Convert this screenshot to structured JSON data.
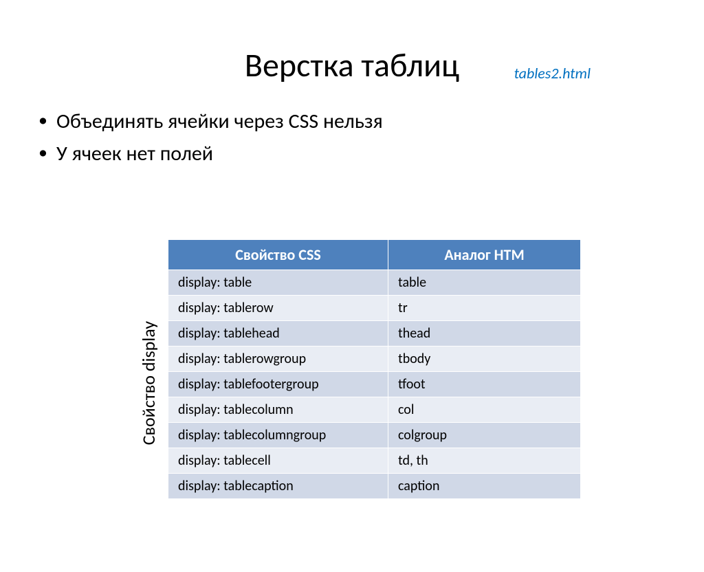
{
  "link_label": "tables2.html",
  "title": "Верстка таблиц",
  "bullets": [
    "Объединять ячейки через CSS нельзя",
    "У ячеек нет полей"
  ],
  "side_label": "Свойство display",
  "table": {
    "headers": [
      "Свойство CSS",
      "Аналог HTM"
    ],
    "rows": [
      [
        "display: table",
        "table"
      ],
      [
        "display: tablerow",
        "tr"
      ],
      [
        "display: tablehead",
        "thead"
      ],
      [
        "display: tablerowgroup",
        "tbody"
      ],
      [
        "display: tablefootergroup",
        "tfoot"
      ],
      [
        "display: tablecolumn",
        "col"
      ],
      [
        "display: tablecolumngroup",
        "colgroup"
      ],
      [
        "display: tablecell",
        "td, th"
      ],
      [
        "display: tablecaption",
        "caption"
      ]
    ]
  }
}
